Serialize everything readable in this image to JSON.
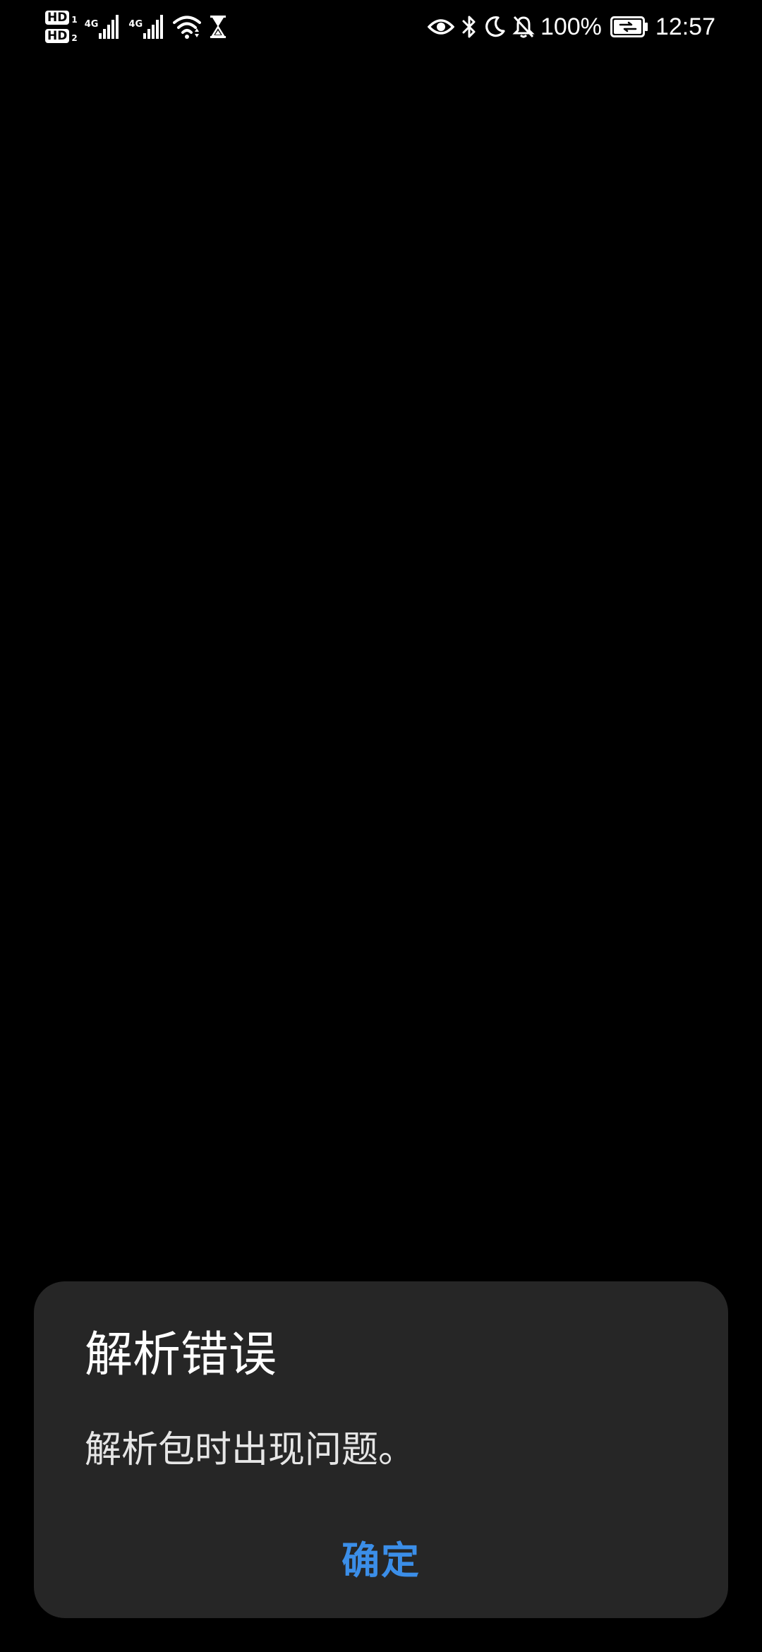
{
  "status_bar": {
    "sim1_badge": "HD",
    "sim1_num": "1",
    "sim2_badge": "HD",
    "sim2_num": "2",
    "sim1_network": "4G",
    "sim2_network": "4G",
    "battery_percent": "100%",
    "time": "12:57",
    "icons": [
      "hd-sim1-icon",
      "hd-sim2-icon",
      "signal-1-icon",
      "signal-2-icon",
      "wifi-icon",
      "hourglass-icon",
      "eye-icon",
      "bluetooth-icon",
      "moon-icon",
      "bell-off-icon",
      "battery-charging-icon"
    ]
  },
  "dialog": {
    "title": "解析错误",
    "message": "解析包时出现问题。",
    "confirm_label": "确定"
  },
  "colors": {
    "background": "#000000",
    "dialog_background": "#262626",
    "accent": "#3b8ee8"
  }
}
